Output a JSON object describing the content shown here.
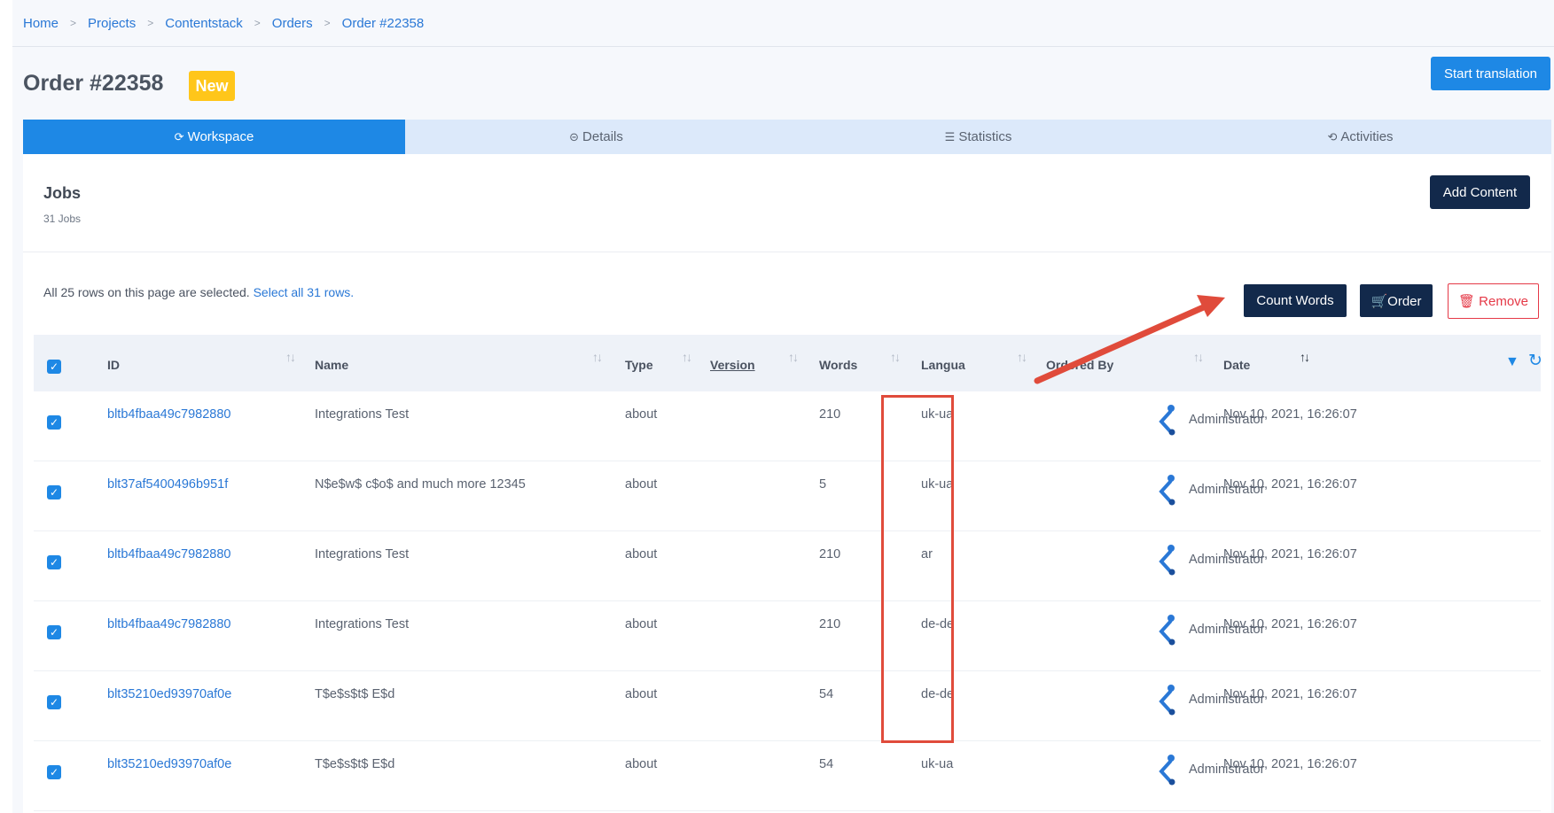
{
  "breadcrumb": [
    "Home",
    "Projects",
    "Contentstack",
    "Orders",
    "Order #22358"
  ],
  "breadcrumb_separator": ">",
  "header": {
    "title": "Order #22358",
    "status": "New",
    "start_button": "Start translation"
  },
  "tabs": [
    {
      "label": "Workspace",
      "icon": "sync-icon",
      "glyph": "⟳",
      "active": true
    },
    {
      "label": "Details",
      "icon": "circle-minus-icon",
      "glyph": "⊝",
      "active": false
    },
    {
      "label": "Statistics",
      "icon": "bar-list-icon",
      "glyph": "☰",
      "active": false
    },
    {
      "label": "Activities",
      "icon": "history-icon",
      "glyph": "⟲",
      "active": false
    }
  ],
  "jobs": {
    "title": "Jobs",
    "count": "31 Jobs",
    "add_content": "Add Content"
  },
  "selection": {
    "text": "All 25 rows on this page are selected.",
    "link": "Select all 31 rows."
  },
  "actions": {
    "count_words": "Count Words",
    "order": "Order",
    "remove": "Remove"
  },
  "table": {
    "columns": [
      "ID",
      "Name",
      "Type",
      "Version",
      "Words",
      "Langua",
      "Ordered By",
      "Date"
    ],
    "rows": [
      {
        "id": "bltb4fbaa49c7982880",
        "name": "Integrations Test",
        "type": "about",
        "version": "",
        "words": "210",
        "language": "uk-ua",
        "ordered_by": "Administrator",
        "date": "Nov 10, 2021, 16:26:07"
      },
      {
        "id": "blt37af5400496b951f",
        "name": "N$e$w$ c$o$ and much more 12345",
        "type": "about",
        "version": "",
        "words": "5",
        "language": "uk-ua",
        "ordered_by": "Administrator",
        "date": "Nov 10, 2021, 16:26:07"
      },
      {
        "id": "bltb4fbaa49c7982880",
        "name": "Integrations Test",
        "type": "about",
        "version": "",
        "words": "210",
        "language": "ar",
        "ordered_by": "Administrator",
        "date": "Nov 10, 2021, 16:26:07"
      },
      {
        "id": "bltb4fbaa49c7982880",
        "name": "Integrations Test",
        "type": "about",
        "version": "",
        "words": "210",
        "language": "de-de",
        "ordered_by": "Administrator",
        "date": "Nov 10, 2021, 16:26:07"
      },
      {
        "id": "blt35210ed93970af0e",
        "name": "T$e$s$t$ E$d",
        "type": "about",
        "version": "",
        "words": "54",
        "language": "de-de",
        "ordered_by": "Administrator",
        "date": "Nov 10, 2021, 16:26:07"
      },
      {
        "id": "blt35210ed93970af0e",
        "name": "T$e$s$t$ E$d",
        "type": "about",
        "version": "",
        "words": "54",
        "language": "uk-ua",
        "ordered_by": "Administrator",
        "date": "Nov 10, 2021, 16:26:07"
      }
    ]
  },
  "colors": {
    "primary": "#1e88e5",
    "dark_button": "#12294b",
    "badge": "#ffc61a",
    "remove": "#e53947",
    "annotation": "#e04b3b"
  }
}
